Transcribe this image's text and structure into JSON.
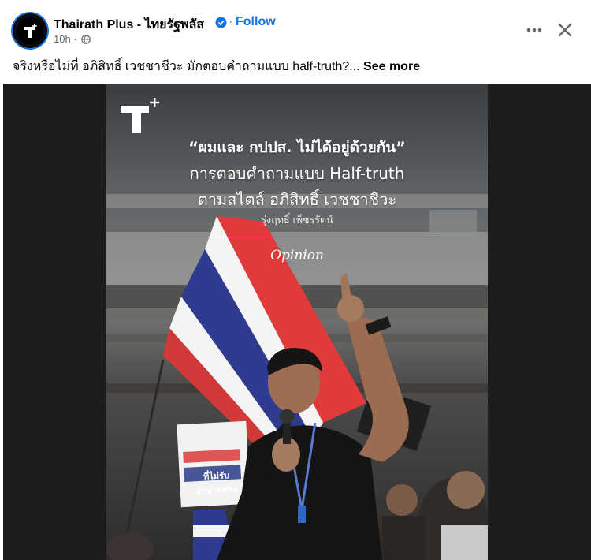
{
  "post": {
    "page_name": "Thairath Plus - ไทยรัฐพลัส",
    "separator": "·",
    "follow_label": "Follow",
    "time": "10h ·",
    "caption_text": "จริงหรือไม่ที่ อภิสิทธิ์ เวชชาชีวะ มักตอบคำถามแบบ half-truth?... ",
    "see_more_label": "See more",
    "accent_color": "#1b74e4"
  },
  "icons": {
    "avatar": "thairath-plus-logo",
    "verified": "verified-badge-icon",
    "privacy": "globe-icon",
    "more": "more-horizontal-icon",
    "close": "close-icon"
  },
  "media": {
    "headline_1": "“ผมและ กปปส. ไม่ได้อยู่ด้วยกัน”",
    "headline_2": "การตอบคำถามแบบ Half-truth",
    "headline_3": "ตามสไตล์ อภิสิทธิ์ เวชชาชีวะ",
    "author": "รุ่งฤทธิ์ เพ็ชรรัตน์",
    "category": "Opinion",
    "protest_sign_text": "ที่ไม่รับ\nอำนาจศาล"
  }
}
